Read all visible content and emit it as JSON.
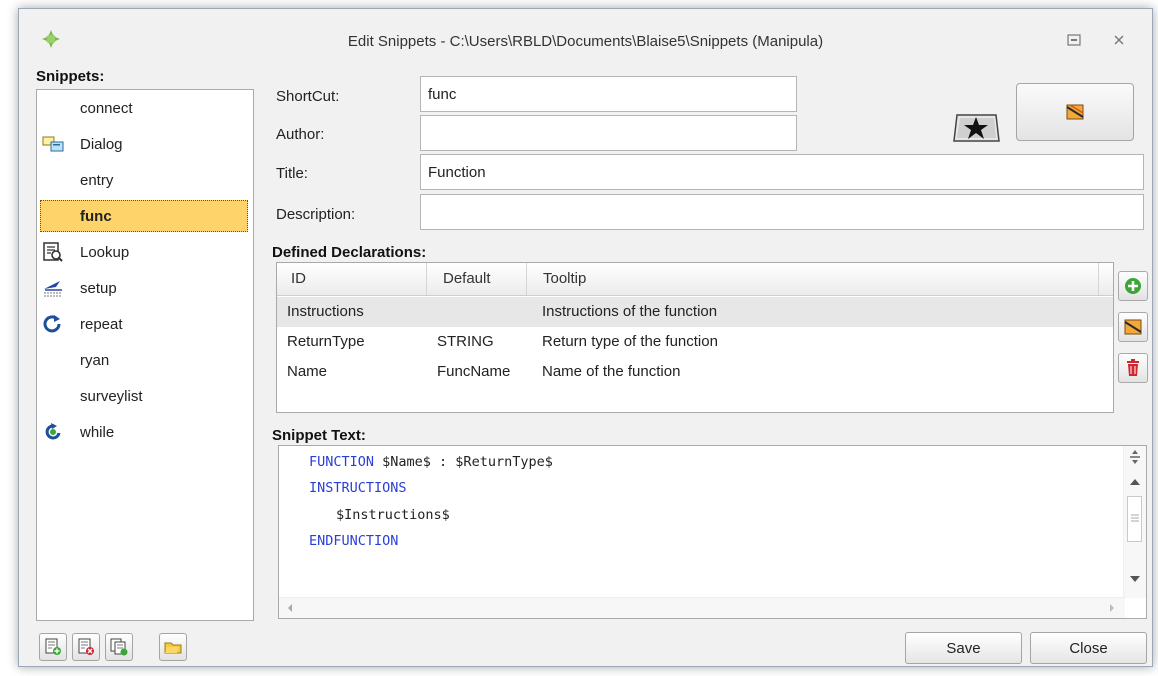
{
  "window": {
    "title": "Edit Snippets - C:\\Users\\RBLD\\Documents\\Blaise5\\Snippets (Manipula)"
  },
  "snippets": {
    "label": "Snippets:",
    "items": [
      {
        "label": "connect",
        "icon": ""
      },
      {
        "label": "Dialog",
        "icon": "dialog-icon"
      },
      {
        "label": "entry",
        "icon": ""
      },
      {
        "label": "func",
        "icon": "",
        "selected": true
      },
      {
        "label": "Lookup",
        "icon": "lookup-icon"
      },
      {
        "label": "setup",
        "icon": "setup-icon"
      },
      {
        "label": "repeat",
        "icon": "repeat-icon"
      },
      {
        "label": "ryan",
        "icon": ""
      },
      {
        "label": "surveylist",
        "icon": ""
      },
      {
        "label": "while",
        "icon": "while-icon"
      }
    ]
  },
  "form": {
    "shortcut_label": "ShortCut:",
    "shortcut_value": "func",
    "author_label": "Author:",
    "author_value": "",
    "title_label": "Title:",
    "title_value": "Function",
    "description_label": "Description:",
    "description_value": ""
  },
  "declarations": {
    "label": "Defined Declarations:",
    "columns": [
      "ID",
      "Default",
      "Tooltip"
    ],
    "rows": [
      {
        "id": "Instructions",
        "default": "",
        "tooltip": "Instructions of the function"
      },
      {
        "id": "ReturnType",
        "default": "STRING",
        "tooltip": "Return type of the function"
      },
      {
        "id": "Name",
        "default": "FuncName",
        "tooltip": "Name of the function"
      }
    ]
  },
  "snippet_text": {
    "label": "Snippet Text:",
    "line1_kw": "FUNCTION",
    "line1_rest": " $Name$ : $ReturnType$",
    "line2": "INSTRUCTIONS",
    "line3": "$Instructions$",
    "line4": "ENDFUNCTION"
  },
  "buttons": {
    "save": "Save",
    "close": "Close"
  },
  "colors": {
    "keyword": "#2a3fd6",
    "selection": "#fdd36a",
    "add_green": "#3aa635",
    "delete_red": "#d0262f"
  }
}
